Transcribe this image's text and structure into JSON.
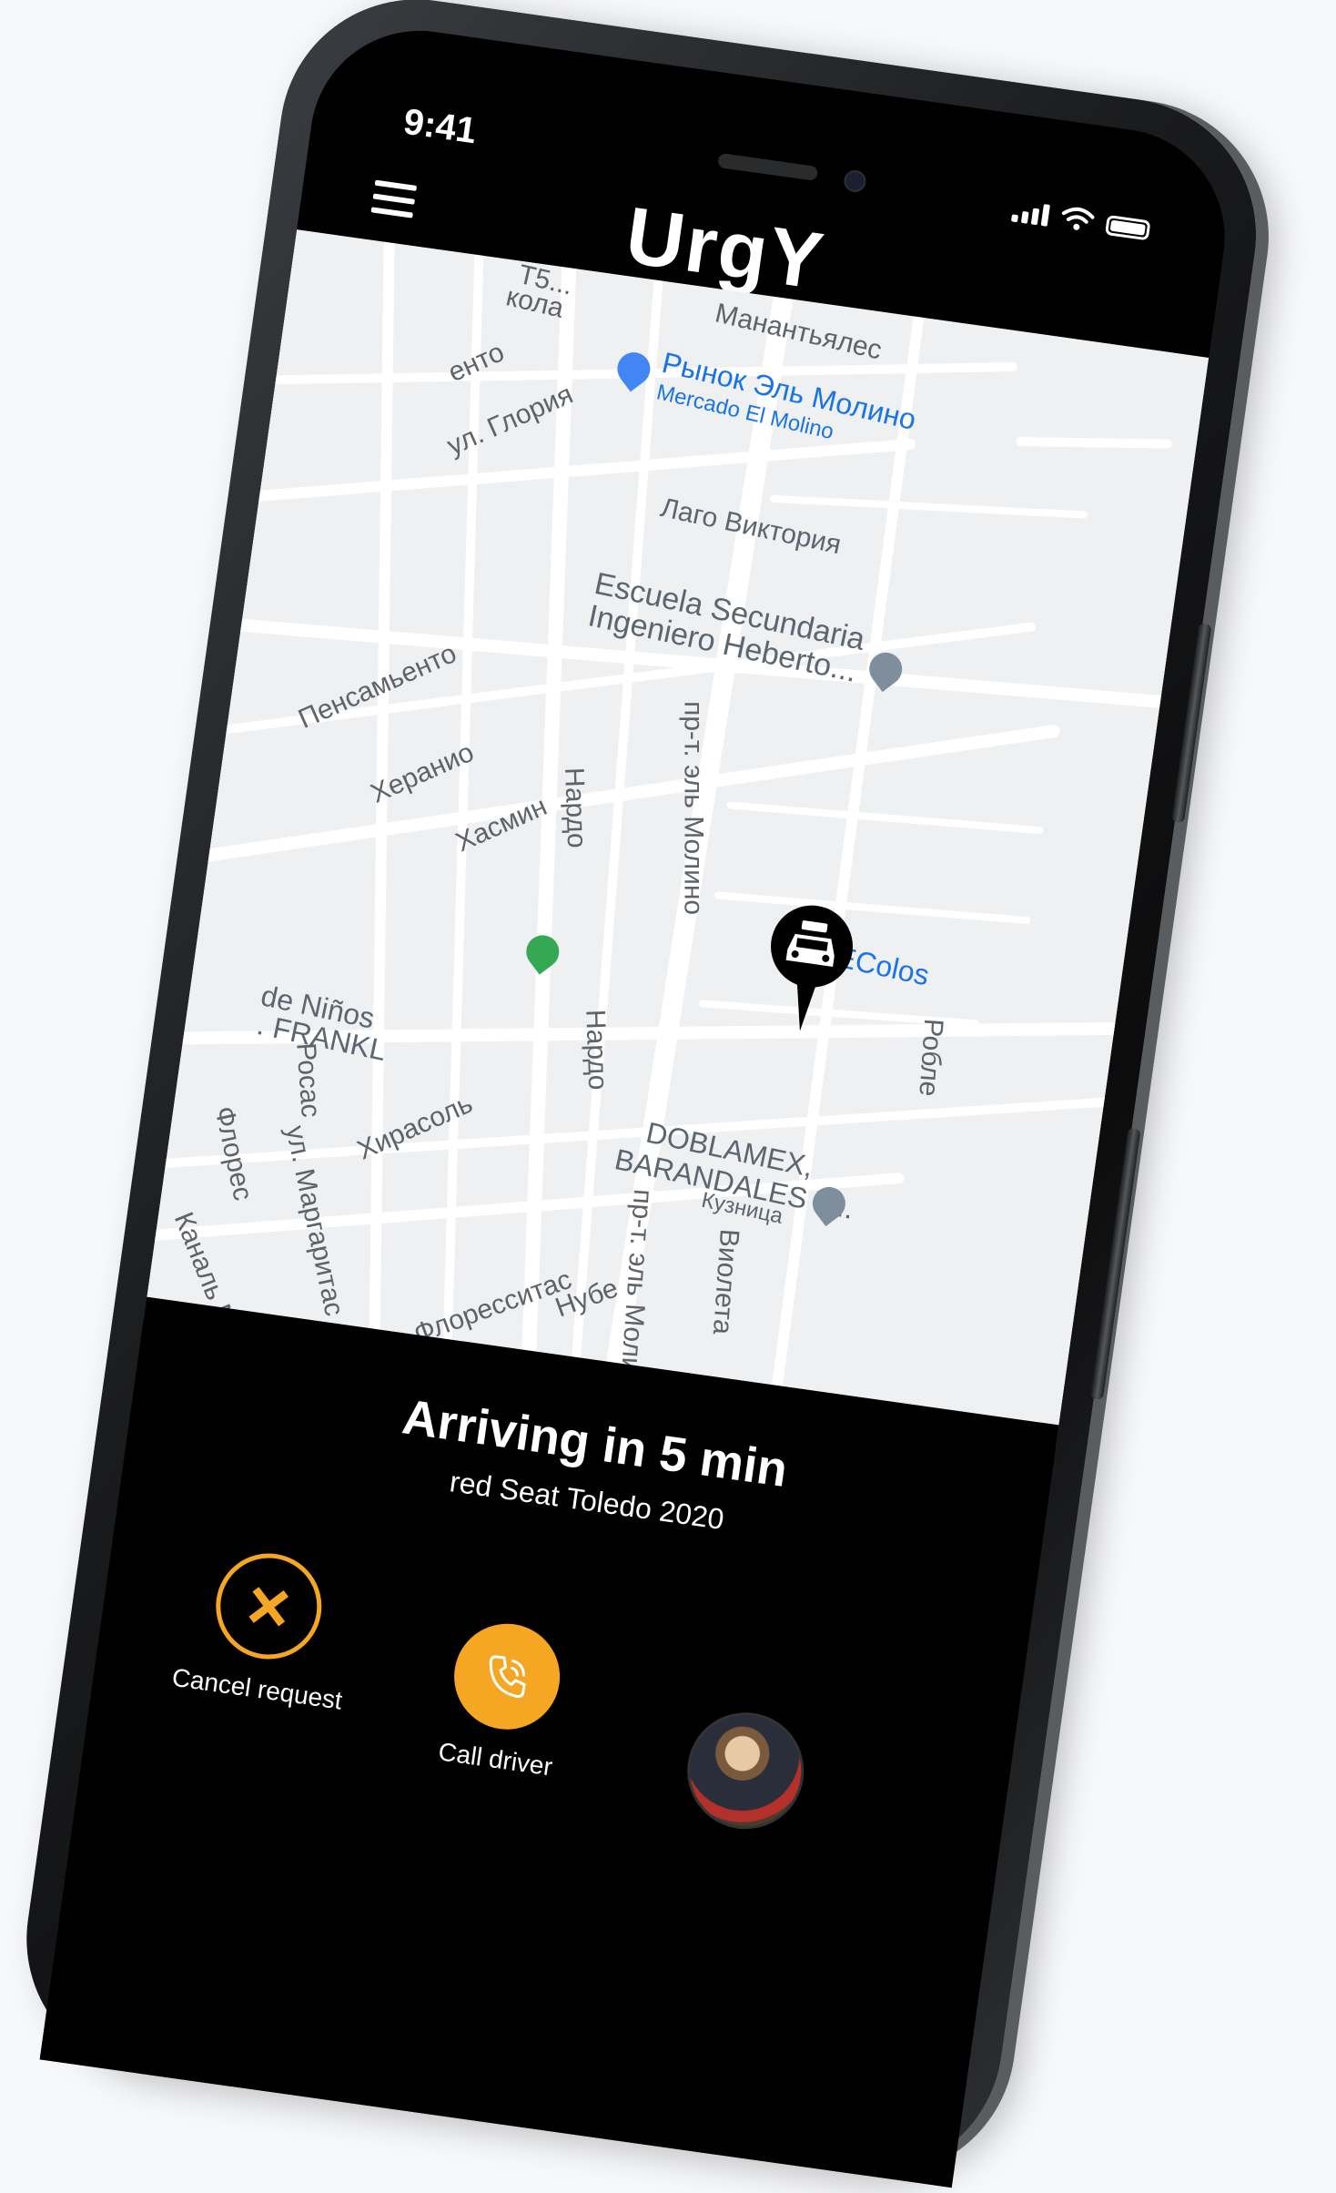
{
  "status_bar": {
    "time": "9:41"
  },
  "header": {
    "logo": "UrgY"
  },
  "map": {
    "labels": [
      {
        "key": "manantial",
        "text": "Манантьялес"
      },
      {
        "key": "market_ru",
        "text": "Рынок Эль Молино"
      },
      {
        "key": "market_es",
        "text": "Mercado El Molino"
      },
      {
        "key": "gloria",
        "text": "ул. Глория"
      },
      {
        "key": "lago",
        "text": "Лаго Виктория"
      },
      {
        "key": "school1",
        "text": "Escuela Secundaria"
      },
      {
        "key": "school2",
        "text": "Ingeniero Heberto..."
      },
      {
        "key": "pensam",
        "text": "Пенсамьенто"
      },
      {
        "key": "geranio",
        "text": "Херанио"
      },
      {
        "key": "jasmin",
        "text": "Хасмин"
      },
      {
        "key": "nardo1",
        "text": "Нардо"
      },
      {
        "key": "molino1",
        "text": "пр-т. эль Молино"
      },
      {
        "key": "ecolos",
        "text": "EColos"
      },
      {
        "key": "ninos1",
        "text": "de Niños"
      },
      {
        "key": "ninos2",
        "text": ". FRANKL"
      },
      {
        "key": "nardo2",
        "text": "Нардо"
      },
      {
        "key": "roble",
        "text": "Робле"
      },
      {
        "key": "rosas",
        "text": "Росас"
      },
      {
        "key": "girasol",
        "text": "Хирасоль"
      },
      {
        "key": "doblamex1",
        "text": "DOBLAMEX,"
      },
      {
        "key": "doblamex2",
        "text": "BARANDALES Y..."
      },
      {
        "key": "kuznitsa",
        "text": "Кузница"
      },
      {
        "key": "flores",
        "text": "Флорес"
      },
      {
        "key": "margaritas",
        "text": "ул. Маргаритас"
      },
      {
        "key": "molino2",
        "text": "пр-т. эль Молино"
      },
      {
        "key": "violeta",
        "text": "Виолета"
      },
      {
        "key": "canal",
        "text": "Каналь Ми"
      },
      {
        "key": "floresitas",
        "text": "Флоресситас"
      },
      {
        "key": "nube",
        "text": "Нубе"
      },
      {
        "key": "top1",
        "text": "T5..."
      },
      {
        "key": "top2",
        "text": "кола"
      },
      {
        "key": "top3",
        "text": "енто"
      }
    ]
  },
  "ride": {
    "arriving": "Arriving in 5 min",
    "car": "red Seat Toledo 2020"
  },
  "actions": {
    "cancel_label": "Cancel request",
    "call_label": "Call driver"
  },
  "colors": {
    "accent": "#f5a623",
    "map_bg": "#eef0f2",
    "road": "#ffffff"
  },
  "icons": [
    "menu-icon",
    "signal-icon",
    "wifi-icon",
    "battery-icon",
    "taxi-pin-icon",
    "close-icon",
    "phone-call-icon",
    "driver-avatar"
  ]
}
